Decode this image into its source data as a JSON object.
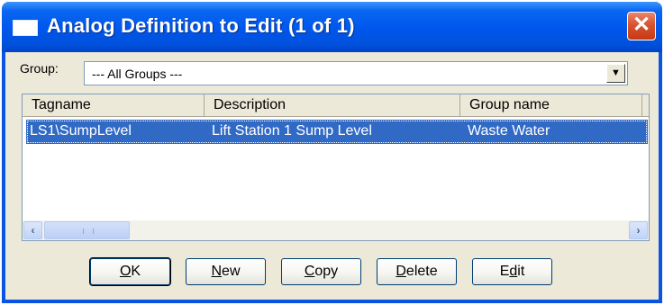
{
  "window": {
    "title": "Analog Definition to Edit (1 of 1)",
    "close_glyph": "✕"
  },
  "group": {
    "label": "Group:",
    "selected": "--- All Groups ---",
    "dropdown_icon": "chevron-down-icon"
  },
  "list": {
    "columns": [
      "Tagname",
      "Description",
      "Group name"
    ],
    "rows": [
      [
        "LS1\\SumpLevel",
        "Lift Station 1 Sump Level",
        "Waste Water"
      ]
    ],
    "selected_row": 0
  },
  "scrollbar": {
    "left_glyph": "‹",
    "right_glyph": "›"
  },
  "buttons": {
    "ok": {
      "mnemonic": "O",
      "rest": "K"
    },
    "new": {
      "mnemonic": "N",
      "rest": "ew"
    },
    "copy": {
      "mnemonic": "C",
      "rest": "opy"
    },
    "delete": {
      "mnemonic": "D",
      "rest": "elete"
    },
    "edit": {
      "first": "E",
      "mnemonic": "d",
      "rest": "it"
    }
  },
  "colors": {
    "titlebar": "#0058ee",
    "selection": "#316ac5",
    "dialog_bg": "#ece9d8",
    "close": "#d9532f"
  }
}
